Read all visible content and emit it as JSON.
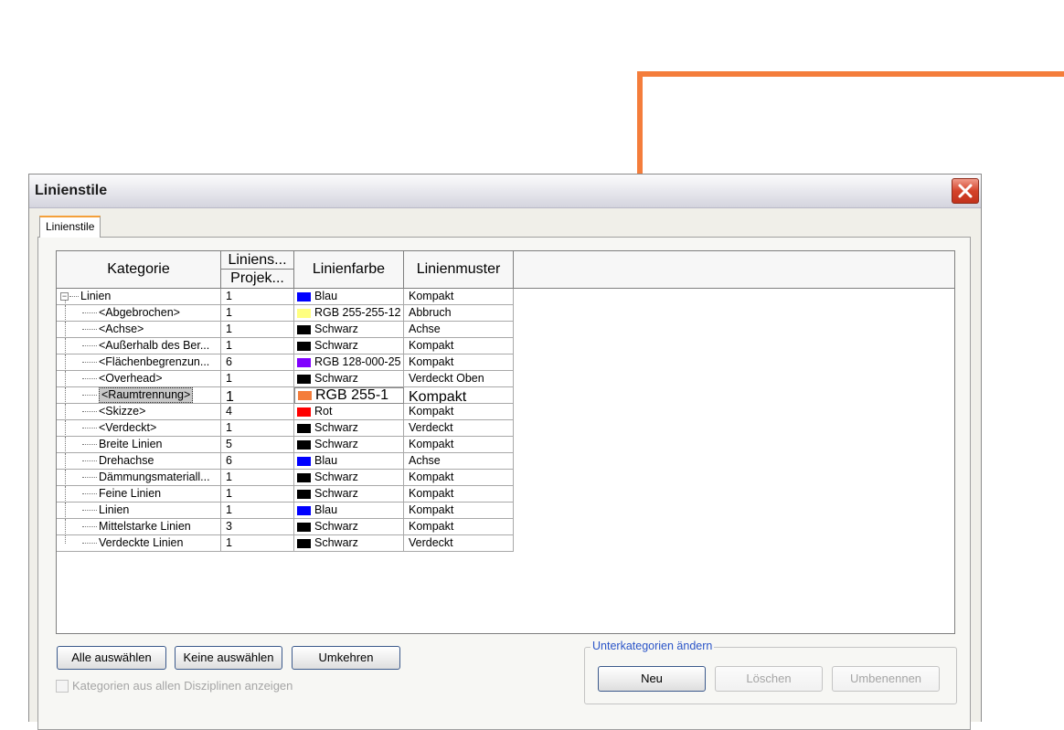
{
  "dialog": {
    "title": "Linienstile",
    "tab_label": "Linienstile"
  },
  "grid": {
    "headers": {
      "kategorie": "Kategorie",
      "linienstaerke_top": "Liniens...",
      "linienstaerke_bottom": "Projek...",
      "linienfarbe": "Linienfarbe",
      "linienmuster": "Linienmuster"
    },
    "rows": [
      {
        "name": "Linien",
        "weight": "1",
        "color": "Blau",
        "hex": "#0000ff",
        "pattern": "Kompakt"
      },
      {
        "name": "<Abgebrochen>",
        "weight": "1",
        "color": "RGB 255-255-12",
        "hex": "#ffff80",
        "pattern": "Abbruch"
      },
      {
        "name": "<Achse>",
        "weight": "1",
        "color": "Schwarz",
        "hex": "#000000",
        "pattern": "Achse"
      },
      {
        "name": "<Außerhalb des Ber...",
        "weight": "1",
        "color": "Schwarz",
        "hex": "#000000",
        "pattern": "Kompakt"
      },
      {
        "name": "<Flächenbegrenzun...",
        "weight": "6",
        "color": "RGB 128-000-25",
        "hex": "#8000ff",
        "pattern": "Kompakt"
      },
      {
        "name": "<Overhead>",
        "weight": "1",
        "color": "Schwarz",
        "hex": "#000000",
        "pattern": "Verdeckt Oben"
      },
      {
        "name": "<Raumtrennung>",
        "weight": "1",
        "color": "RGB 255-1",
        "hex": "#f47d3b",
        "pattern": "Kompakt"
      },
      {
        "name": "<Skizze>",
        "weight": "4",
        "color": "Rot",
        "hex": "#ff0000",
        "pattern": "Kompakt"
      },
      {
        "name": "<Verdeckt>",
        "weight": "1",
        "color": "Schwarz",
        "hex": "#000000",
        "pattern": "Verdeckt"
      },
      {
        "name": "Breite Linien",
        "weight": "5",
        "color": "Schwarz",
        "hex": "#000000",
        "pattern": "Kompakt"
      },
      {
        "name": "Drehachse",
        "weight": "6",
        "color": "Blau",
        "hex": "#0000ff",
        "pattern": "Achse"
      },
      {
        "name": "Dämmungsmateriall...",
        "weight": "1",
        "color": "Schwarz",
        "hex": "#000000",
        "pattern": "Kompakt"
      },
      {
        "name": "Feine Linien",
        "weight": "1",
        "color": "Schwarz",
        "hex": "#000000",
        "pattern": "Kompakt"
      },
      {
        "name": "Linien",
        "weight": "1",
        "color": "Blau",
        "hex": "#0000ff",
        "pattern": "Kompakt"
      },
      {
        "name": "Mittelstarke Linien",
        "weight": "3",
        "color": "Schwarz",
        "hex": "#000000",
        "pattern": "Kompakt"
      },
      {
        "name": "Verdeckte Linien",
        "weight": "1",
        "color": "Schwarz",
        "hex": "#000000",
        "pattern": "Verdeckt"
      }
    ]
  },
  "buttons": {
    "select_all": "Alle auswählen",
    "select_none": "Keine auswählen",
    "invert": "Umkehren"
  },
  "checkbox": {
    "label": "Kategorien aus allen Disziplinen anzeigen",
    "checked": false
  },
  "subcategories": {
    "legend": "Unterkategorien ändern",
    "new": "Neu",
    "delete": "Löschen",
    "rename": "Umbenennen"
  },
  "colors": {
    "accent_orange": "#f47d3b",
    "legend_blue": "#2b55c8"
  }
}
